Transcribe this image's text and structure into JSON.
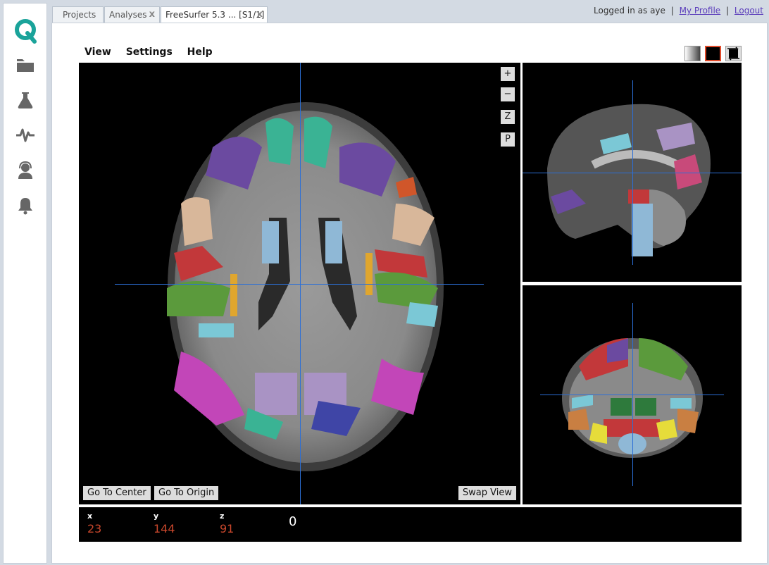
{
  "tabs": [
    {
      "label": "Projects",
      "closable": false
    },
    {
      "label": "Analyses",
      "closable": true
    },
    {
      "label": "FreeSurfer 5.3 ... [S1/1]",
      "closable": true,
      "active": true
    }
  ],
  "tab_close_glyph": "x",
  "user": {
    "logged_in_prefix": "Logged in as",
    "username": "aye",
    "separator": "|",
    "profile_link": "My Profile",
    "logout_link": "Logout"
  },
  "sidebar": {
    "logo": "q-logo",
    "items": [
      {
        "icon": "folder-icon"
      },
      {
        "icon": "flask-icon"
      },
      {
        "icon": "activity-pulse-icon"
      },
      {
        "icon": "support-agent-icon"
      },
      {
        "icon": "bell-icon"
      }
    ]
  },
  "menu": {
    "view": "View",
    "settings": "Settings",
    "help": "Help"
  },
  "view_buttons": [
    "grayscale-gradient-icon",
    "black-background-icon",
    "swap-layout-icon"
  ],
  "viewer": {
    "zoom_in": "+",
    "zoom_out": "−",
    "z_button": "Z",
    "p_button": "P",
    "go_to_center": "Go To Center",
    "go_to_origin": "Go To Origin",
    "swap_view": "Swap View"
  },
  "coordinates": {
    "x_label": "x",
    "x_value": "23",
    "y_label": "y",
    "y_value": "144",
    "z_label": "z",
    "z_value": "91",
    "intensity": "0"
  },
  "colors": {
    "accent_blue": "#2c6fd6",
    "coord_value": "#c9472c",
    "selected_border": "#e04a2a",
    "logo_teal": "#1aa39a"
  }
}
